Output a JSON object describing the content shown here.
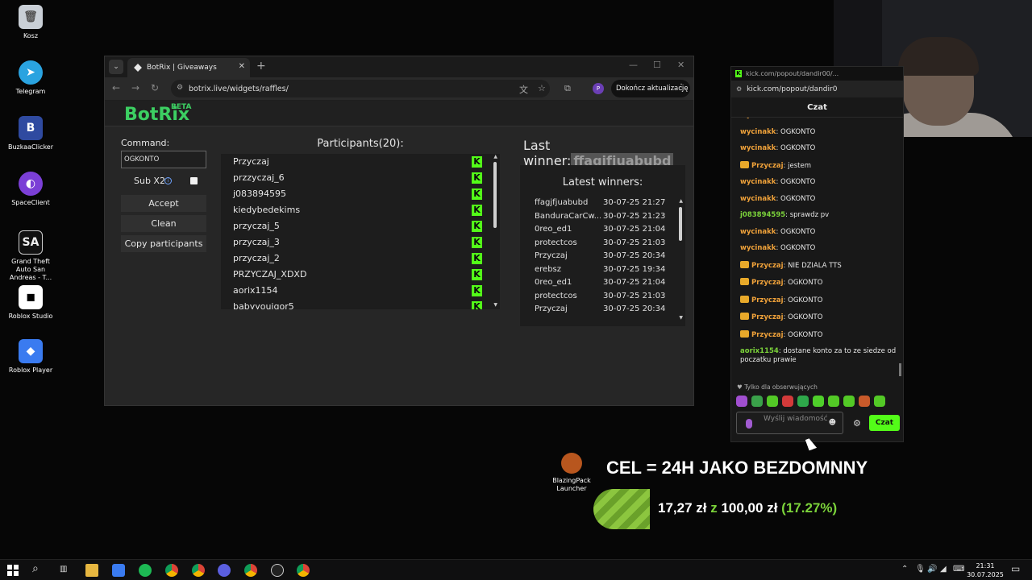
{
  "desktop_icons": [
    {
      "label": "Kosz",
      "icon": "recycle-bin-icon",
      "color": "#9aa3ad"
    },
    {
      "label": "Telegram",
      "icon": "telegram-icon",
      "color": "#2aa3e0"
    },
    {
      "label": "BuzkaaClicker",
      "icon": "buzkaa-icon",
      "color": "#2f4aa0"
    },
    {
      "label": "SpaceClient",
      "icon": "spaceclient-icon",
      "color": "#7b3fd6"
    },
    {
      "label": "Grand Theft Auto San Andreas - T...",
      "icon": "gta-icon",
      "color": "#ddd"
    },
    {
      "label": "Roblox Studio",
      "icon": "roblox-studio-icon",
      "color": "#ffffff"
    },
    {
      "label": "Roblox Player",
      "icon": "roblox-player-icon",
      "color": "#3a7bf0"
    }
  ],
  "browser": {
    "tab_title": "BotRix | Giveaways",
    "url": "botrix.live/widgets/raffles/",
    "update_button": "Dokończ aktualizację",
    "profile_letter": "P"
  },
  "botrix": {
    "logo": "BotRix",
    "beta": "BETA",
    "command_label": "Command:",
    "command_value": "OGKONTO",
    "sub_label": "Sub X2",
    "buttons": [
      "Accept",
      "Clean",
      "Copy participants"
    ],
    "participants_title": "Participants(20):",
    "participants": [
      "Przyczaj",
      "przzyczaj_6",
      "j083894595",
      "kiedybedekims",
      "przyczaj_5",
      "przyczaj_3",
      "przyczaj_2",
      "PRZYCZAJ_XDXD",
      "aorix1154",
      "babyyouiqor5"
    ],
    "last_winner_label": "Last winner:",
    "last_winner": "ffagjfjuabubd",
    "latest_winners_title": "Latest winners:",
    "latest_winners": [
      {
        "name": "ffagjfjuabubd",
        "date": "30-07-25 21:27"
      },
      {
        "name": "BanduraCarCw...",
        "date": "30-07-25 21:23"
      },
      {
        "name": "0reo_ed1",
        "date": "30-07-25 21:04"
      },
      {
        "name": "protectcos",
        "date": "30-07-25 21:03"
      },
      {
        "name": "Przyczaj",
        "date": "30-07-25 20:34"
      },
      {
        "name": "erebsz",
        "date": "30-07-25 19:34"
      },
      {
        "name": "0reo_ed1",
        "date": "30-07-25 21:04"
      },
      {
        "name": "protectcos",
        "date": "30-07-25 21:03"
      },
      {
        "name": "Przyczaj",
        "date": "30-07-25 20:34"
      }
    ]
  },
  "chat": {
    "window_title": "kick.com/popout/dandir00/...",
    "url": "kick.com/popout/dandir0",
    "header": "Czat",
    "messages": [
      {
        "user": "wycinakk",
        "text": "OGKONTO",
        "color": "#f0a23a",
        "badge": false
      },
      {
        "user": "wycinakk",
        "text": "OGKONTO",
        "color": "#f0a23a",
        "badge": false
      },
      {
        "user": "wycinakk",
        "text": "OGKONTO",
        "color": "#f0a23a",
        "badge": false
      },
      {
        "user": "Przyczaj",
        "text": "jestem",
        "color": "#f0a23a",
        "badge": true
      },
      {
        "user": "wycinakk",
        "text": "OGKONTO",
        "color": "#f0a23a",
        "badge": false
      },
      {
        "user": "wycinakk",
        "text": "OGKONTO",
        "color": "#f0a23a",
        "badge": false
      },
      {
        "user": "j083894595",
        "text": "sprawdz pv",
        "color": "#7bd23a",
        "badge": false
      },
      {
        "user": "wycinakk",
        "text": "OGKONTO",
        "color": "#f0a23a",
        "badge": false
      },
      {
        "user": "wycinakk",
        "text": "OGKONTO",
        "color": "#f0a23a",
        "badge": false
      },
      {
        "user": "Przyczaj",
        "text": "NIE DZIALA TTS",
        "color": "#f0a23a",
        "badge": true
      },
      {
        "user": "Przyczaj",
        "text": "OGKONTO",
        "color": "#f0a23a",
        "badge": true
      },
      {
        "user": "Przyczaj",
        "text": "OGKONTO",
        "color": "#f0a23a",
        "badge": true
      },
      {
        "user": "Przyczaj",
        "text": "OGKONTO",
        "color": "#f0a23a",
        "badge": true
      },
      {
        "user": "Przyczaj",
        "text": "OGKONTO",
        "color": "#f0a23a",
        "badge": true
      },
      {
        "user": "aorix1154",
        "text": "dostane konto za to ze siedze od poczatku prawie",
        "color": "#7bd23a",
        "badge": false
      }
    ],
    "followers_only": "Tylko dla obserwujących",
    "input_placeholder": "Wyślij wiadomość",
    "send_label": "Czat"
  },
  "goal": {
    "title": "CEL = 24H JAKO BEZDOMNNY",
    "current": "17,27 zł",
    "z": "z",
    "target": "100,00 zł",
    "percent": "(17.27%)"
  },
  "blazing": {
    "label": "BlazingPack Launcher"
  },
  "taskbar": {
    "time": "21:31",
    "date": "30.07.2025"
  }
}
